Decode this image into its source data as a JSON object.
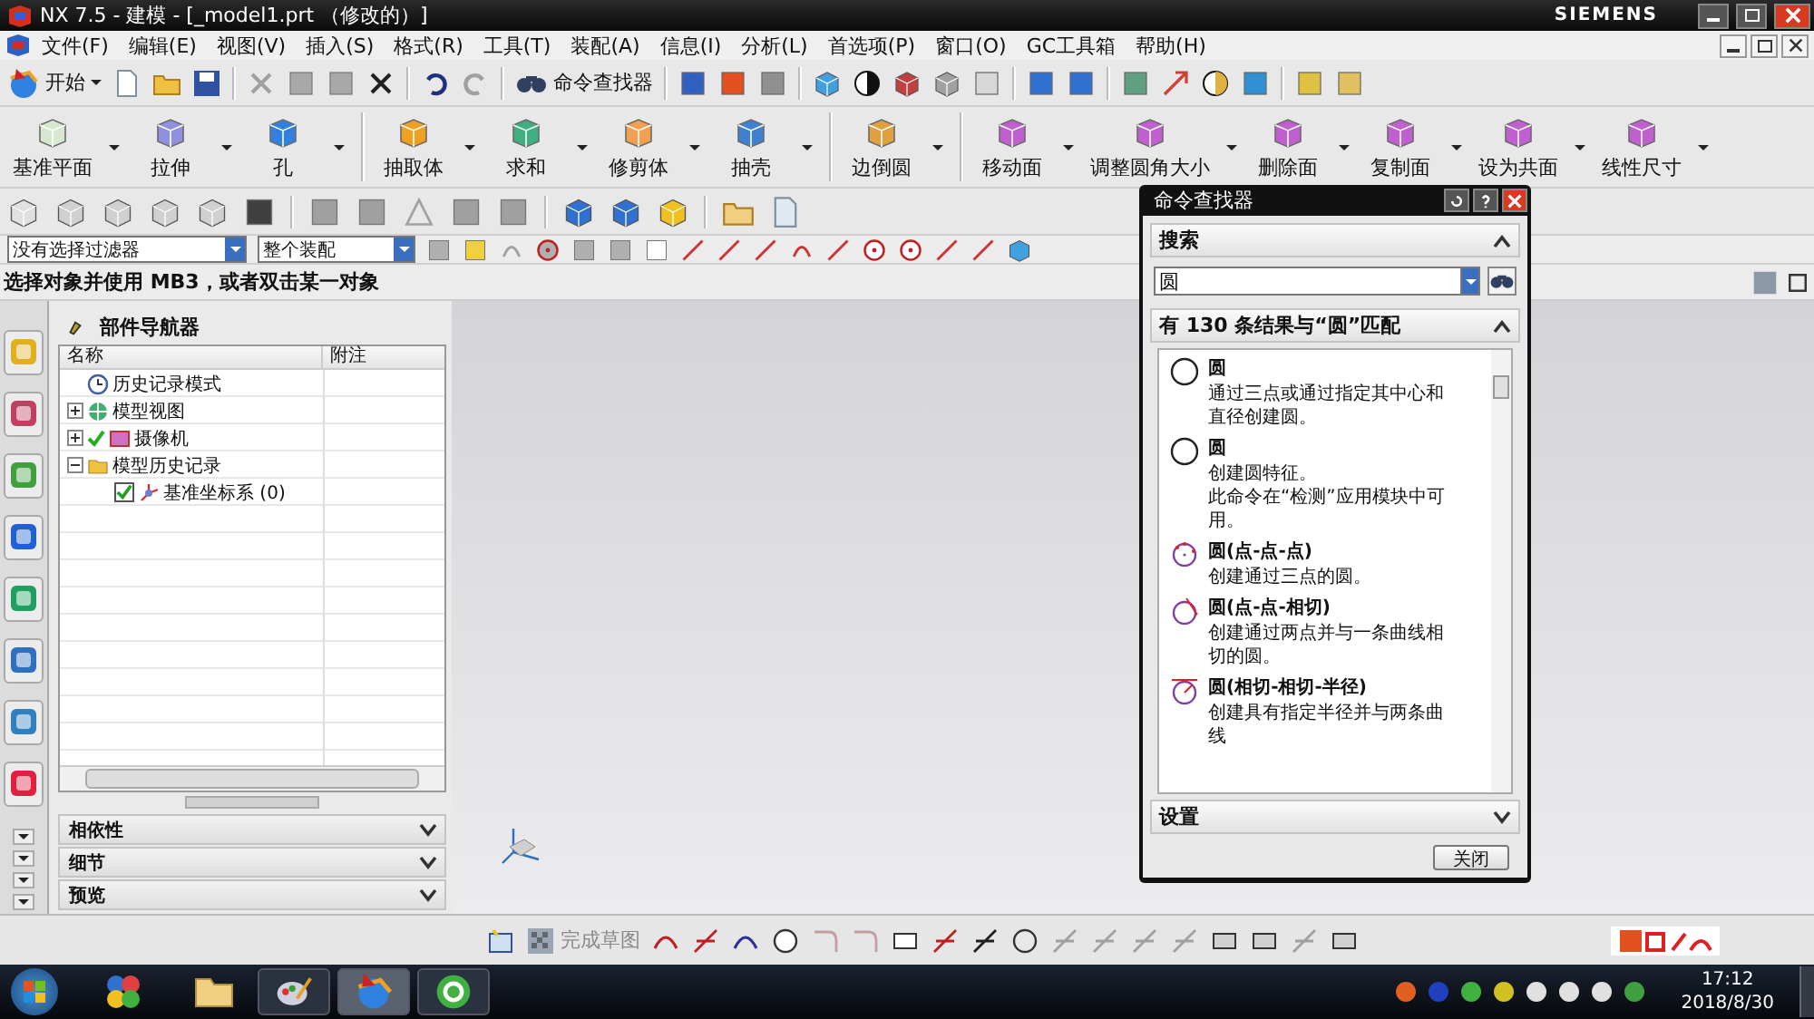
{
  "window": {
    "title": "NX 7.5 - 建模 - [_model1.prt （修改的）]",
    "brand": "SIEMENS"
  },
  "menu": [
    "文件(F)",
    "编辑(E)",
    "视图(V)",
    "插入(S)",
    "格式(R)",
    "工具(T)",
    "装配(A)",
    "信息(I)",
    "分析(L)",
    "首选项(P)",
    "窗口(O)",
    "GC工具箱",
    "帮助(H)"
  ],
  "standard_toolbar": {
    "start": "开始",
    "command_finder": "命令查找器"
  },
  "feature_toolbar": [
    "基准平面",
    "拉伸",
    "孔",
    "抽取体",
    "求和",
    "修剪体",
    "抽壳",
    "边倒圆",
    "移动面",
    "调整圆角大小",
    "删除面",
    "复制面",
    "设为共面",
    "线性尺寸"
  ],
  "selection_bar": {
    "type_filter": "没有选择过滤器",
    "scope": "整个装配"
  },
  "prompt": "选择对象并使用 MB3，或者双击某一对象",
  "navigator": {
    "title": "部件导航器",
    "columns": [
      "名称",
      "附注"
    ],
    "nodes": [
      {
        "label": "历史记录模式",
        "kind": "mode"
      },
      {
        "label": "模型视图",
        "kind": "views",
        "expanded": false
      },
      {
        "label": "摄像机",
        "kind": "cameras",
        "expanded": false,
        "checked": true
      },
      {
        "label": "模型历史记录",
        "kind": "folder",
        "expanded": true,
        "children": [
          {
            "label": "基准坐标系 (0)",
            "kind": "csys",
            "checked": true
          }
        ]
      }
    ],
    "panels": [
      {
        "label": "相依性",
        "expanded": false
      },
      {
        "label": "细节",
        "expanded": false
      },
      {
        "label": "预览",
        "expanded": false
      }
    ]
  },
  "command_finder": {
    "title": "命令查找器",
    "search_section": {
      "label": "搜索",
      "expanded": true
    },
    "search_value": "圆",
    "results_header": {
      "label": "有 130 条结果与“圆”匹配",
      "expanded": true
    },
    "results": [
      {
        "kind": "plain",
        "title": "圆",
        "description": [
          "通过三点或通过指定其中心和直径创建圆。"
        ]
      },
      {
        "kind": "plain",
        "title": "圆",
        "description": [
          "创建圆特征。",
          "此命令在“检测”应用模块中可用。"
        ]
      },
      {
        "kind": "points",
        "title": "圆(点-点-点)",
        "description": [
          "创建通过三点的圆。"
        ]
      },
      {
        "kind": "tangent",
        "title": "圆(点-点-相切)",
        "description": [
          "创建通过两点并与一条曲线相切的圆。"
        ]
      },
      {
        "kind": "radius",
        "title": "圆(相切-相切-半径)",
        "description": [
          "创建具有指定半径并与两条曲线"
        ]
      }
    ],
    "settings_section": {
      "label": "设置",
      "expanded": false
    },
    "close": "关闭"
  },
  "sketch_toolbar": {
    "finish_sketch": "完成草图"
  },
  "taskbar": {
    "time": "17:12",
    "date": "2018/8/30"
  }
}
